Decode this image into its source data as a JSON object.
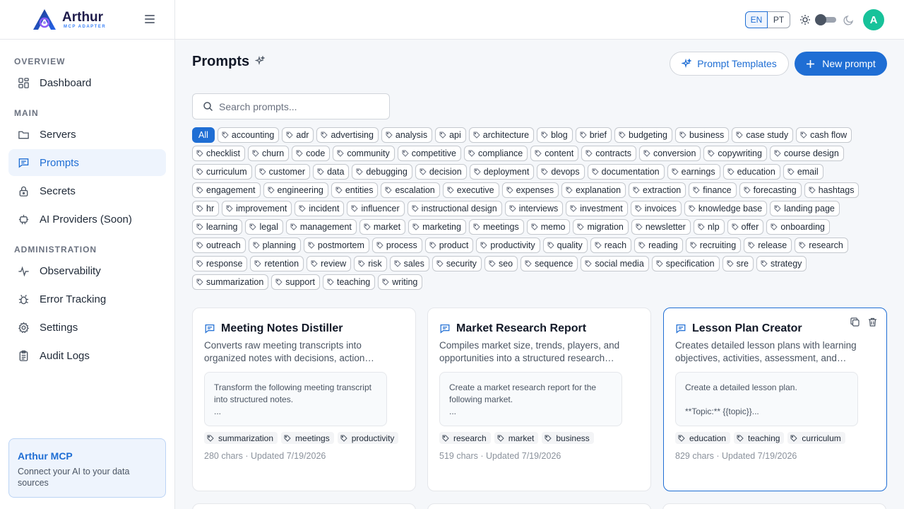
{
  "brand": {
    "name": "Arthur",
    "subtitle": "MCP ADAPTER"
  },
  "sidebar": {
    "sections": {
      "overview": "OVERVIEW",
      "main": "MAIN",
      "administration": "ADMINISTRATION"
    },
    "items": [
      {
        "label": "Dashboard",
        "icon": "dashboard-icon"
      },
      {
        "label": "Servers",
        "icon": "folder-icon"
      },
      {
        "label": "Prompts",
        "icon": "message-icon",
        "active": true
      },
      {
        "label": "Secrets",
        "icon": "lock-icon"
      },
      {
        "label": "AI Providers (Soon)",
        "icon": "bot-icon"
      },
      {
        "label": "Observability",
        "icon": "activity-icon"
      },
      {
        "label": "Error Tracking",
        "icon": "bug-icon"
      },
      {
        "label": "Settings",
        "icon": "gear-icon"
      },
      {
        "label": "Audit Logs",
        "icon": "clipboard-icon"
      }
    ],
    "promo": {
      "title": "Arthur MCP",
      "text": "Connect your AI to your data sources"
    }
  },
  "header": {
    "lang_en": "EN",
    "lang_pt": "PT",
    "avatar_initial": "A",
    "avatar_color": "#17c29a"
  },
  "main": {
    "title": "Prompts",
    "templates_button": "Prompt Templates",
    "new_button": "New prompt",
    "search_placeholder": "Search prompts...",
    "filter_all": "All",
    "filter_tags": [
      "accounting",
      "adr",
      "advertising",
      "analysis",
      "api",
      "architecture",
      "blog",
      "brief",
      "budgeting",
      "business",
      "case study",
      "cash flow",
      "checklist",
      "churn",
      "code",
      "community",
      "competitive",
      "compliance",
      "content",
      "contracts",
      "conversion",
      "copywriting",
      "course design",
      "curriculum",
      "customer",
      "data",
      "debugging",
      "decision",
      "deployment",
      "devops",
      "documentation",
      "earnings",
      "education",
      "email",
      "engagement",
      "engineering",
      "entities",
      "escalation",
      "executive",
      "expenses",
      "explanation",
      "extraction",
      "finance",
      "forecasting",
      "hashtags",
      "hr",
      "improvement",
      "incident",
      "influencer",
      "instructional design",
      "interviews",
      "investment",
      "invoices",
      "knowledge base",
      "landing page",
      "learning",
      "legal",
      "management",
      "market",
      "marketing",
      "meetings",
      "memo",
      "migration",
      "newsletter",
      "nlp",
      "offer",
      "onboarding",
      "outreach",
      "planning",
      "postmortem",
      "process",
      "product",
      "productivity",
      "quality",
      "reach",
      "reading",
      "recruiting",
      "release",
      "research",
      "response",
      "retention",
      "review",
      "risk",
      "sales",
      "security",
      "seo",
      "sequence",
      "social media",
      "specification",
      "sre",
      "strategy",
      "summarization",
      "support",
      "teaching",
      "writing"
    ],
    "cards": [
      {
        "title": "Meeting Notes Distiller",
        "description": "Converts raw meeting transcripts into organized notes with decisions, action…",
        "preview": "Transform the following meeting transcript into structured notes.\n...",
        "tags": [
          "summarization",
          "meetings",
          "productivity"
        ],
        "meta": "280 chars · Updated 7/19/2026"
      },
      {
        "title": "Market Research Report",
        "description": "Compiles market size, trends, players, and opportunities into a structured research…",
        "preview": "Create a market research report for the following market.\n...",
        "tags": [
          "research",
          "market",
          "business"
        ],
        "meta": "519 chars · Updated 7/19/2026"
      },
      {
        "title": "Lesson Plan Creator",
        "description": "Creates detailed lesson plans with learning objectives, activities, assessment, and…",
        "preview": "Create a detailed lesson plan.\n\n**Topic:** {{topic}}...",
        "tags": [
          "education",
          "teaching",
          "curriculum"
        ],
        "meta": "829 chars · Updated 7/19/2026"
      }
    ]
  },
  "colors": {
    "accent": "#1f6ed4",
    "active_bg": "#eef4fd"
  }
}
